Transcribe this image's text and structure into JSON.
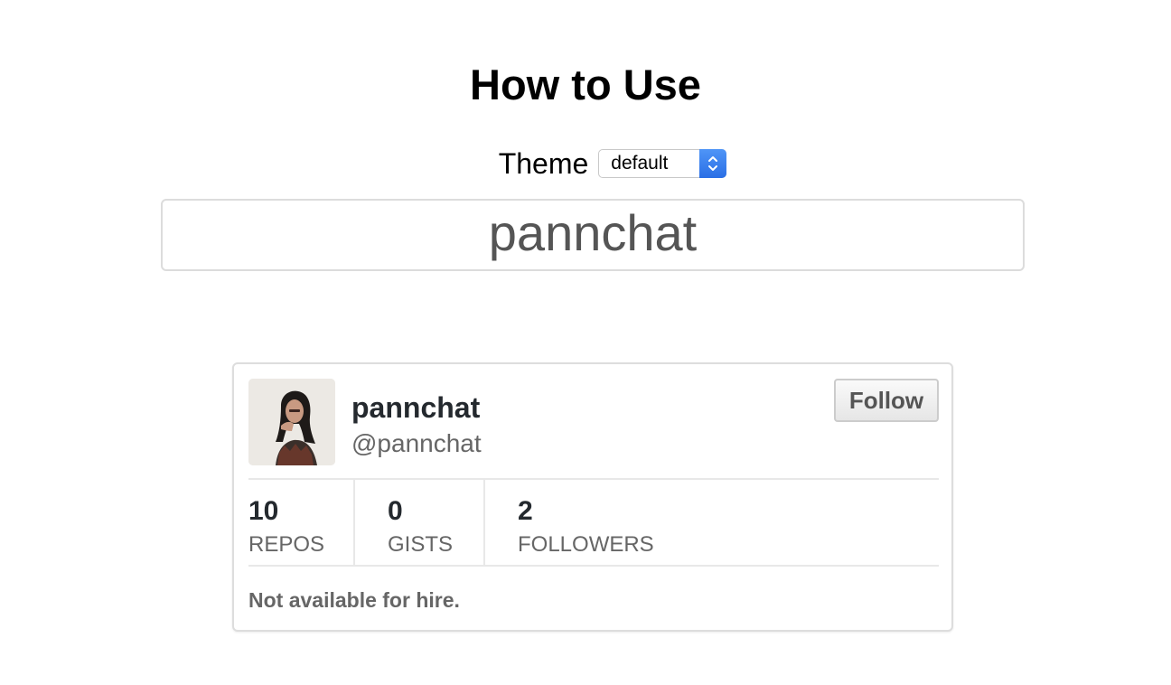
{
  "page": {
    "title": "How to Use"
  },
  "theme": {
    "label": "Theme",
    "selected": "default",
    "accent": "#2f7cf0"
  },
  "search": {
    "value": "pannchat"
  },
  "card": {
    "name": "pannchat",
    "handle": "@pannchat",
    "follow_label": "Follow",
    "stats": [
      {
        "value": "10",
        "label": "REPOS"
      },
      {
        "value": "0",
        "label": "GISTS"
      },
      {
        "value": "2",
        "label": "FOLLOWERS"
      }
    ],
    "hire_status": "Not available for hire."
  }
}
